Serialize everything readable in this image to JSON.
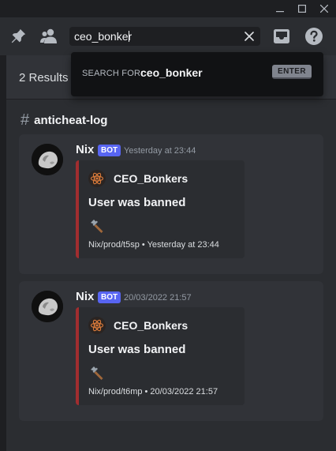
{
  "toolbar": {
    "search_value": "ceo_bonker"
  },
  "dropdown": {
    "label": "SEARCH FOR:",
    "value": "ceo_bonker",
    "enter_key": "ENTER"
  },
  "results": {
    "count_label": "2 Results",
    "channel_hash": "#",
    "channel_name": "anticheat-log",
    "items": [
      {
        "author": "Nix",
        "bot_tag": "BOT",
        "timestamp": "Yesterday at 23:44",
        "embed": {
          "author": "CEO_Bonkers",
          "title": "User was banned",
          "emoji": "hammer",
          "footer": "Nix/prod/t5sp • Yesterday at 23:44",
          "accent_color": "#a12d2f"
        }
      },
      {
        "author": "Nix",
        "bot_tag": "BOT",
        "timestamp": "20/03/2022 21:57",
        "embed": {
          "author": "CEO_Bonkers",
          "title": "User was banned",
          "emoji": "hammer",
          "footer": "Nix/prod/t6mp • 20/03/2022 21:57",
          "accent_color": "#a12d2f"
        }
      }
    ]
  },
  "colors": {
    "bot_tag": "#5865f2",
    "embed_accent": "#a12d2f"
  }
}
